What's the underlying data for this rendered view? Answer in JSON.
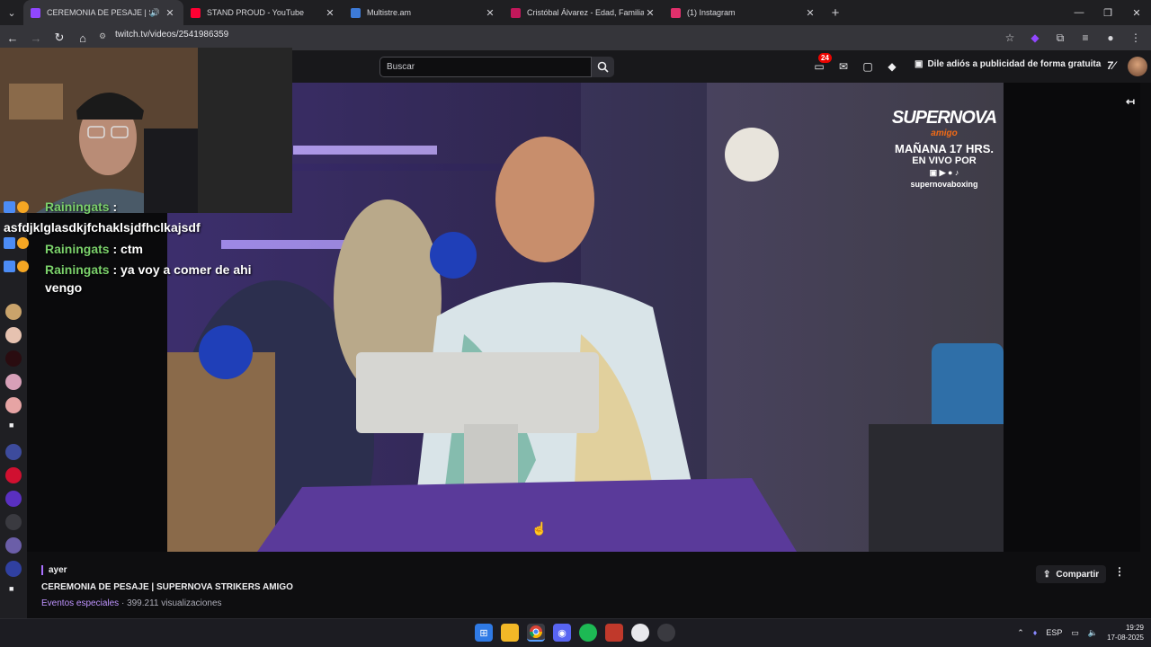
{
  "browser": {
    "tabs": [
      {
        "title": "CEREMONIA DE PESAJE | SUPERNOVA",
        "icon": "twitch-icon",
        "color": "#9147ff",
        "active": true
      },
      {
        "title": "STAND PROUD - YouTube",
        "icon": "youtube-icon",
        "color": "#ff0033"
      },
      {
        "title": "Multistre.am",
        "icon": "multistream-icon",
        "color": "#3d7bd9"
      },
      {
        "title": "Cristóbal Álvarez - Edad, Familia",
        "icon": "site-icon",
        "color": "#c2185b"
      },
      {
        "title": "(1) Instagram",
        "icon": "instagram-icon",
        "color": "#e1306c"
      }
    ],
    "url": "twitch.tv/videos/2541986359"
  },
  "twitch": {
    "search_placeholder": "Buscar",
    "notifications_count": "24",
    "promo_label": "Dile adiós a publicidad de forma gratuita"
  },
  "overlay": {
    "brand": "SUPERNOVA",
    "sub_brand": "amigo",
    "schedule": "MAÑANA 17 HRS.",
    "live_on": "EN VIVO POR",
    "handle": "supernovaboxing"
  },
  "chat": [
    {
      "user": "Rainingats",
      "message": "asfdjklglasdkjfchaklsjdfhclkajsdf",
      "partial": true
    },
    {
      "user": "Rainingats",
      "message": "ctm"
    },
    {
      "user": "Rainingats",
      "message": "ya voy a comer de ahi vengo"
    }
  ],
  "video_meta": {
    "date": "ayer",
    "title": "CEREMONIA DE PESAJE | SUPERNOVA STRIKERS AMIGO",
    "category": "Eventos especiales",
    "views": "399.211 visualizaciones",
    "share_label": "Compartir"
  },
  "taskbar": {
    "lang": "ESP",
    "time": "19:29",
    "date": "17-08-2025"
  },
  "colors": {
    "twitch_purple": "#9147ff",
    "chat_name": "#7bd16b"
  }
}
